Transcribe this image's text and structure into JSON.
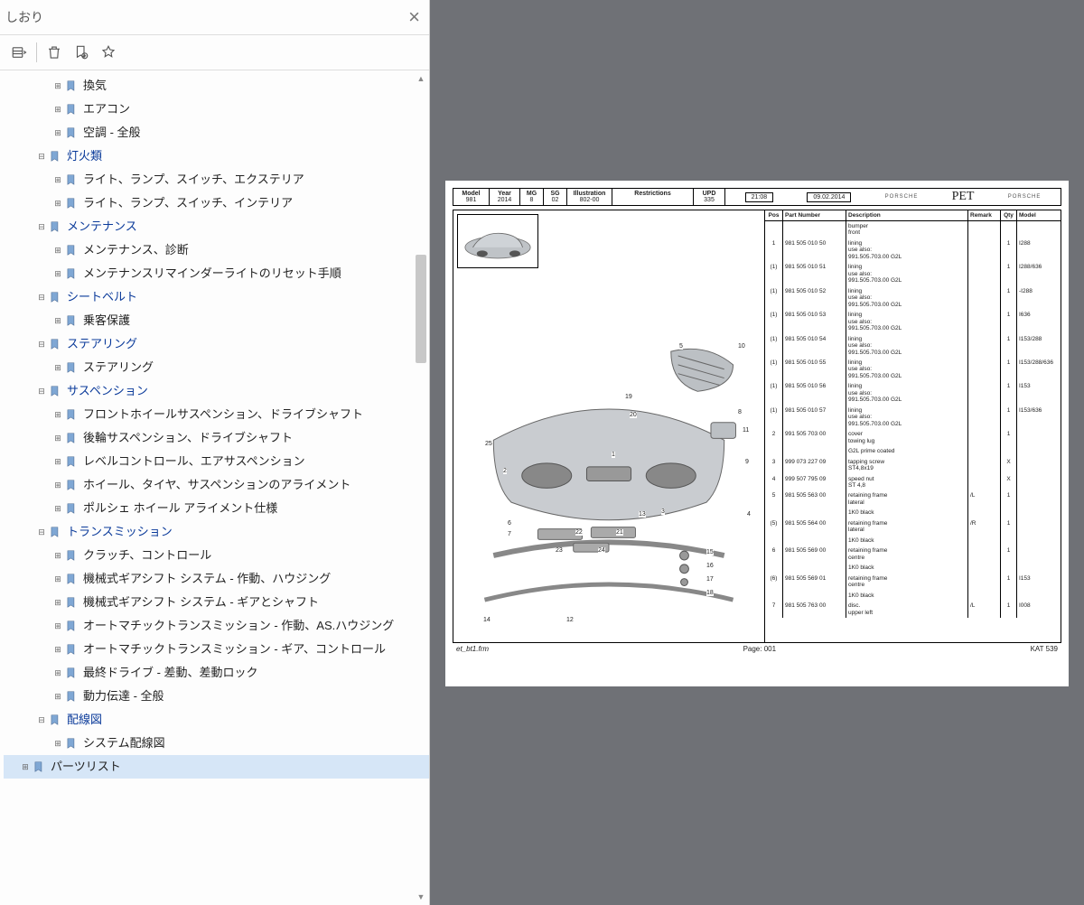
{
  "sidebar": {
    "title": "しおり",
    "toolbar": {
      "options": "options",
      "delete": "delete",
      "add": "add-bookmark",
      "star": "star"
    },
    "scroll": {
      "up": "▲",
      "down": "▼"
    }
  },
  "tree": [
    {
      "indent": 3,
      "twist": "⊞",
      "cat": false,
      "label": "換気",
      "name": "node-ventilation"
    },
    {
      "indent": 3,
      "twist": "⊞",
      "cat": false,
      "label": "エアコン",
      "name": "node-aircon"
    },
    {
      "indent": 3,
      "twist": "⊞",
      "cat": false,
      "label": "空調 - 全般",
      "name": "node-climate-general"
    },
    {
      "indent": 2,
      "twist": "⊟",
      "cat": true,
      "label": "灯火類",
      "name": "node-lights"
    },
    {
      "indent": 3,
      "twist": "⊞",
      "cat": false,
      "label": "ライト、ランプ、スイッチ、エクステリア",
      "name": "node-lights-ext"
    },
    {
      "indent": 3,
      "twist": "⊞",
      "cat": false,
      "label": "ライト、ランプ、スイッチ、インテリア",
      "name": "node-lights-int"
    },
    {
      "indent": 2,
      "twist": "⊟",
      "cat": true,
      "label": "メンテナンス",
      "name": "node-maint"
    },
    {
      "indent": 3,
      "twist": "⊞",
      "cat": false,
      "label": "メンテナンス、診断",
      "name": "node-maint-diag"
    },
    {
      "indent": 3,
      "twist": "⊞",
      "cat": false,
      "label": "メンテナンスリマインダーライトのリセット手順",
      "name": "node-maint-reset"
    },
    {
      "indent": 2,
      "twist": "⊟",
      "cat": true,
      "label": "シートベルト",
      "name": "node-seatbelt"
    },
    {
      "indent": 3,
      "twist": "⊞",
      "cat": false,
      "label": "乗客保護",
      "name": "node-passenger-protection"
    },
    {
      "indent": 2,
      "twist": "⊟",
      "cat": true,
      "label": "ステアリング",
      "name": "node-steering"
    },
    {
      "indent": 3,
      "twist": "⊞",
      "cat": false,
      "label": "ステアリング",
      "name": "node-steering-sub"
    },
    {
      "indent": 2,
      "twist": "⊟",
      "cat": true,
      "label": "サスペンション",
      "name": "node-suspension"
    },
    {
      "indent": 3,
      "twist": "⊞",
      "cat": false,
      "label": "フロントホイールサスペンション、ドライブシャフト",
      "name": "node-front-susp"
    },
    {
      "indent": 3,
      "twist": "⊞",
      "cat": false,
      "label": "後輪サスペンション、ドライブシャフト",
      "name": "node-rear-susp"
    },
    {
      "indent": 3,
      "twist": "⊞",
      "cat": false,
      "label": "レベルコントロール、エアサスペンション",
      "name": "node-level-ctrl"
    },
    {
      "indent": 3,
      "twist": "⊞",
      "cat": false,
      "label": "ホイール、タイヤ、サスペンションのアライメント",
      "name": "node-wheel-align"
    },
    {
      "indent": 3,
      "twist": "⊞",
      "cat": false,
      "label": "ポルシェ ホイール アライメント仕様",
      "name": "node-porsche-align"
    },
    {
      "indent": 2,
      "twist": "⊟",
      "cat": true,
      "label": "トランスミッション",
      "name": "node-trans"
    },
    {
      "indent": 3,
      "twist": "⊞",
      "cat": false,
      "label": "クラッチ、コントロール",
      "name": "node-clutch"
    },
    {
      "indent": 3,
      "twist": "⊞",
      "cat": false,
      "label": "機械式ギアシフト システム - 作動、ハウジング",
      "name": "node-gearshift-housing"
    },
    {
      "indent": 3,
      "twist": "⊞",
      "cat": false,
      "label": "機械式ギアシフト システム - ギアとシャフト",
      "name": "node-gearshift-shaft"
    },
    {
      "indent": 3,
      "twist": "⊞",
      "cat": false,
      "label": "オートマチックトランスミッション - 作動、AS.ハウジング",
      "name": "node-auto-housing"
    },
    {
      "indent": 3,
      "twist": "⊞",
      "cat": false,
      "label": "オートマチックトランスミッション - ギア、コントロール",
      "name": "node-auto-gear"
    },
    {
      "indent": 3,
      "twist": "⊞",
      "cat": false,
      "label": "最終ドライブ - 差動、差動ロック",
      "name": "node-final-drive"
    },
    {
      "indent": 3,
      "twist": "⊞",
      "cat": false,
      "label": "動力伝達 - 全般",
      "name": "node-power"
    },
    {
      "indent": 2,
      "twist": "⊟",
      "cat": true,
      "label": "配線図",
      "name": "node-wiring"
    },
    {
      "indent": 3,
      "twist": "⊞",
      "cat": false,
      "label": "システム配線図",
      "name": "node-sys-wiring"
    },
    {
      "indent": 1,
      "twist": "⊞",
      "cat": false,
      "label": "パーツリスト",
      "name": "node-parts-list",
      "sel": true
    }
  ],
  "doc": {
    "header_labels": {
      "model": "Model",
      "year": "Year",
      "mg": "MG",
      "sg": "SG",
      "illu": "Illustration",
      "restr": "Restrictions",
      "upd": "UPD"
    },
    "header_vals": {
      "model": "981",
      "year": "2014",
      "mg": "8",
      "sg": "02",
      "illu": "802-00",
      "restr": "",
      "upd": "335"
    },
    "time": "21:08",
    "date": "09.02.2014",
    "brand": "PORSCHE",
    "pet": "PET",
    "table_head": {
      "pos": "Pos",
      "pn": "Part Number",
      "desc": "Description",
      "rem": "Remark",
      "qty": "Qty",
      "mdl": "Model"
    },
    "rows": [
      {
        "pos": "",
        "pn": "",
        "desc": "bumper\nfront",
        "rem": "",
        "qty": "",
        "mdl": ""
      },
      {
        "pos": "1",
        "pn": "981 505 010 50",
        "desc": "lining\nuse also:\n991.505.703.00 G2L",
        "rem": "",
        "qty": "1",
        "mdl": "I288"
      },
      {
        "pos": "(1)",
        "pn": "981 505 010 51",
        "desc": "lining\nuse also:\n991.505.703.00 G2L",
        "rem": "",
        "qty": "1",
        "mdl": "I288/636"
      },
      {
        "pos": "(1)",
        "pn": "981 505 010 52",
        "desc": "lining\nuse also:\n991.505.703.00 G2L",
        "rem": "",
        "qty": "1",
        "mdl": "-I288"
      },
      {
        "pos": "(1)",
        "pn": "981 505 010 53",
        "desc": "lining\nuse also:\n991.505.703.00 G2L",
        "rem": "",
        "qty": "1",
        "mdl": "I636"
      },
      {
        "pos": "(1)",
        "pn": "981 505 010 54",
        "desc": "lining\nuse also:\n991.505.703.00 G2L",
        "rem": "",
        "qty": "1",
        "mdl": "I153/288"
      },
      {
        "pos": "(1)",
        "pn": "981 505 010 55",
        "desc": "lining\nuse also:\n991.505.703.00 G2L",
        "rem": "",
        "qty": "1",
        "mdl": "I153/288/636"
      },
      {
        "pos": "(1)",
        "pn": "981 505 010 56",
        "desc": "lining\nuse also:\n991.505.703.00 G2L",
        "rem": "",
        "qty": "1",
        "mdl": "I153"
      },
      {
        "pos": "(1)",
        "pn": "981 505 010 57",
        "desc": "lining\nuse also:\n991.505.703.00 G2L",
        "rem": "",
        "qty": "1",
        "mdl": "I153/636"
      },
      {
        "pos": "2",
        "pn": "991 505 703 00",
        "desc": "cover\ntowing lug",
        "rem": "",
        "qty": "1",
        "mdl": ""
      },
      {
        "pos": "",
        "pn": "",
        "desc": "G2L    prime coated",
        "rem": "",
        "qty": "",
        "mdl": ""
      },
      {
        "pos": "3",
        "pn": "999 073 227 09",
        "desc": "tapping screw\nST4,8x19",
        "rem": "",
        "qty": "X",
        "mdl": ""
      },
      {
        "pos": "4",
        "pn": "999 507 795 09",
        "desc": "speed nut\nST 4,8",
        "rem": "",
        "qty": "X",
        "mdl": ""
      },
      {
        "pos": "5",
        "pn": "981 505 563 00",
        "desc": "retaining frame\nlateral",
        "rem": "/L",
        "qty": "1",
        "mdl": ""
      },
      {
        "pos": "",
        "pn": "",
        "desc": "1K0    black",
        "rem": "",
        "qty": "",
        "mdl": ""
      },
      {
        "pos": "(5)",
        "pn": "981 505 564 00",
        "desc": "retaining frame\nlateral",
        "rem": "/R",
        "qty": "1",
        "mdl": ""
      },
      {
        "pos": "",
        "pn": "",
        "desc": "1K0    black",
        "rem": "",
        "qty": "",
        "mdl": ""
      },
      {
        "pos": "6",
        "pn": "981 505 569 00",
        "desc": "retaining frame\ncentre",
        "rem": "",
        "qty": "1",
        "mdl": ""
      },
      {
        "pos": "",
        "pn": "",
        "desc": "1K0    black",
        "rem": "",
        "qty": "",
        "mdl": ""
      },
      {
        "pos": "(6)",
        "pn": "981 505 569 01",
        "desc": "retaining frame\ncentre",
        "rem": "",
        "qty": "1",
        "mdl": "I153"
      },
      {
        "pos": "",
        "pn": "",
        "desc": "1K0    black",
        "rem": "",
        "qty": "",
        "mdl": ""
      },
      {
        "pos": "7",
        "pn": "981 505 763 00",
        "desc": "disc.\nupper left",
        "rem": "/L",
        "qty": "1",
        "mdl": "I008"
      }
    ],
    "callouts": [
      "1",
      "2",
      "3",
      "4",
      "5",
      "6",
      "7",
      "8",
      "9",
      "10",
      "11",
      "12",
      "13",
      "14",
      "15",
      "16",
      "17",
      "18",
      "19",
      "20",
      "21",
      "22",
      "23",
      "24",
      "25"
    ],
    "footer": {
      "left": "et_bt1.frm",
      "center": "Page: 001",
      "right": "KAT 539"
    }
  }
}
